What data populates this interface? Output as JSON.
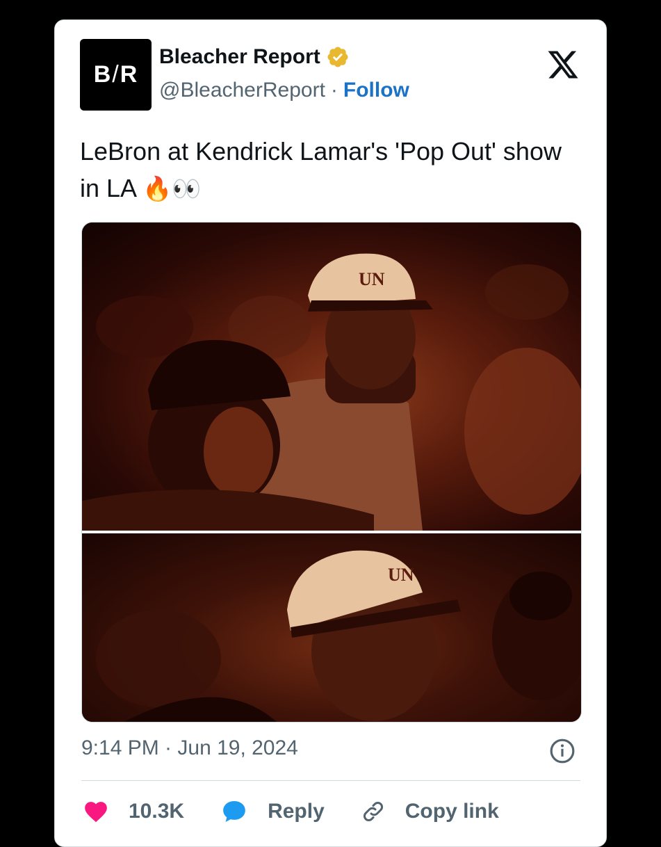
{
  "account": {
    "avatar_text_left": "B",
    "avatar_text_slash": "/",
    "avatar_text_right": "R",
    "name": "Bleacher Report",
    "handle": "@BleacherReport",
    "separator": "·",
    "follow_label": "Follow"
  },
  "tweet": {
    "text": "LeBron at Kendrick Lamar's 'Pop Out' show in LA",
    "emoji": "🔥👀",
    "image_count": 2,
    "timestamp": "9:14 PM · Jun 19, 2024"
  },
  "actions": {
    "likes": "10.3K",
    "reply_label": "Reply",
    "copy_link_label": "Copy link"
  },
  "colors": {
    "accent": "#1a73c7",
    "like": "#f91880",
    "reply": "#1d9bf0",
    "muted": "#536471",
    "verified": "#e8b830"
  },
  "icons": [
    "x-logo-icon",
    "verified-badge-icon",
    "info-icon",
    "heart-icon",
    "reply-bubble-icon",
    "link-icon"
  ]
}
